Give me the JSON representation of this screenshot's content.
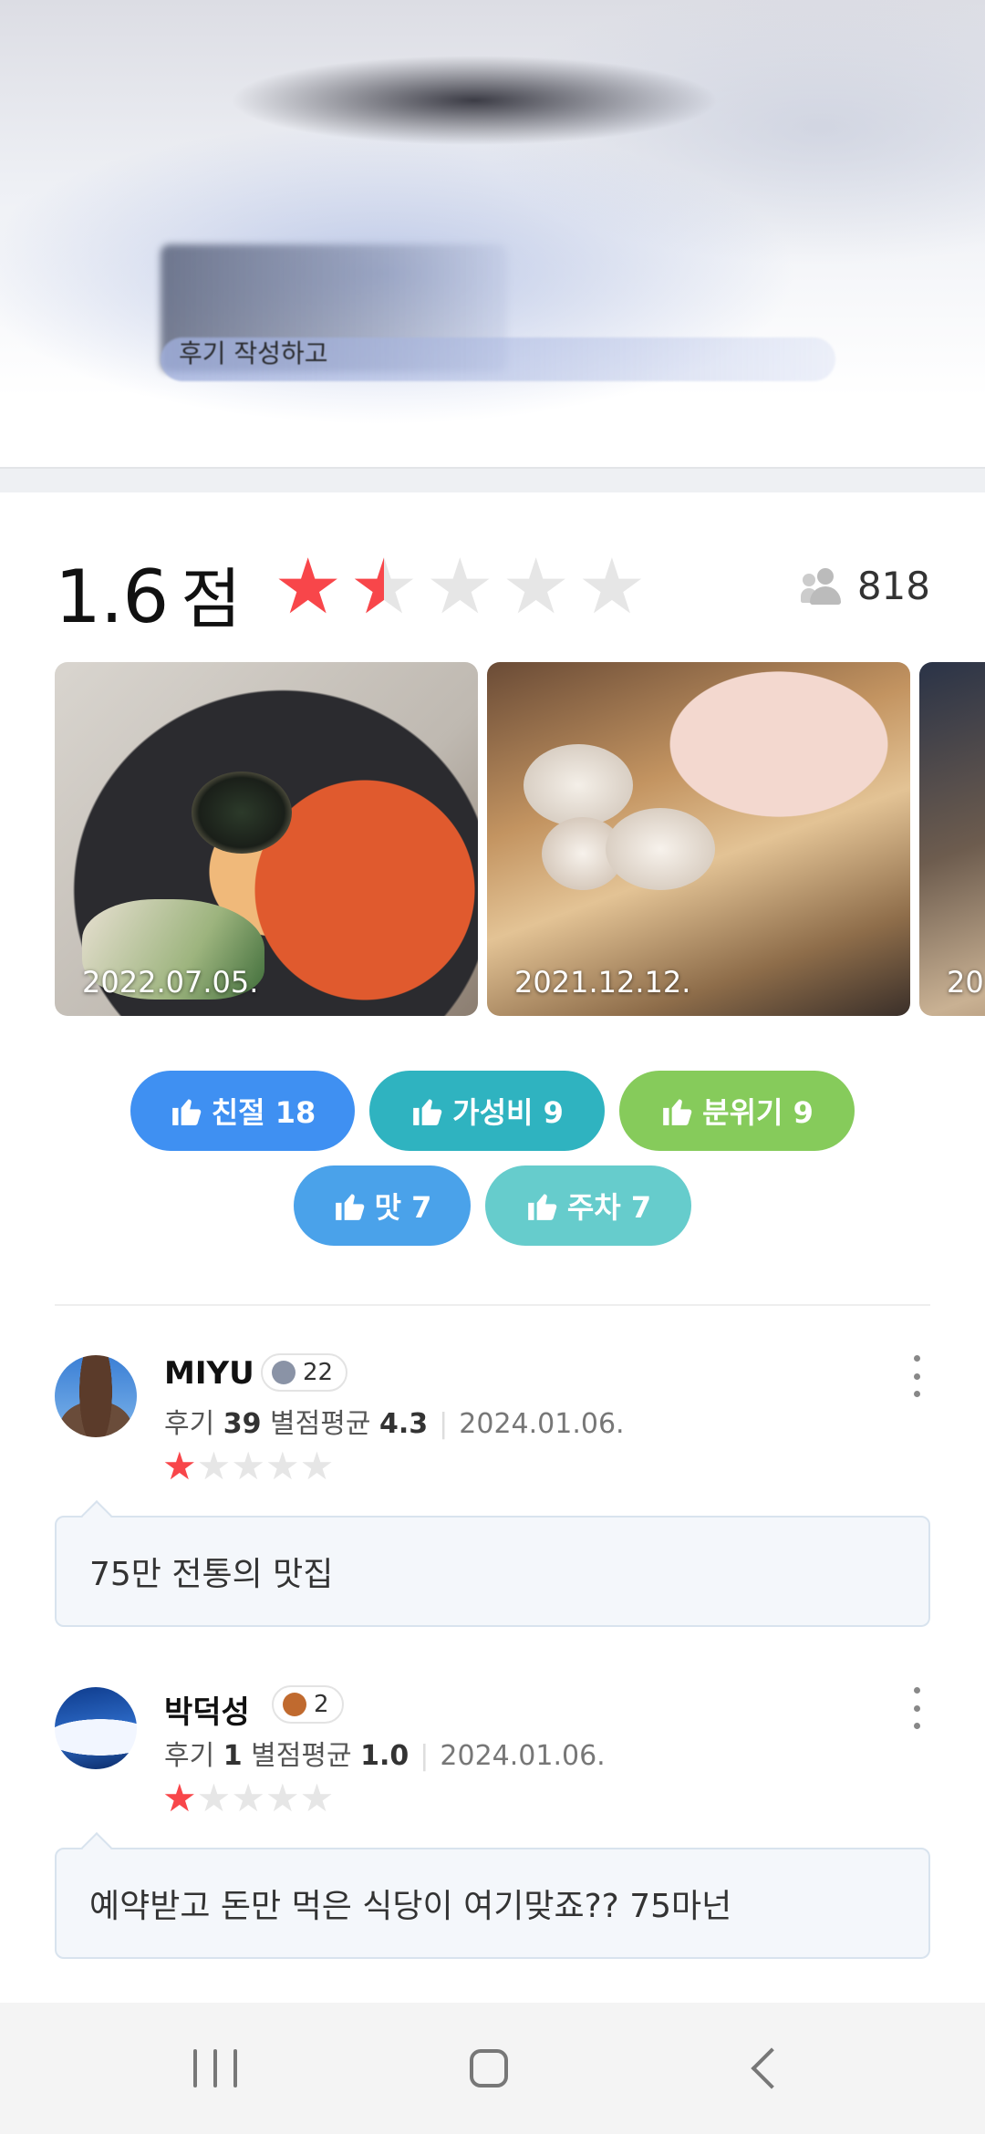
{
  "hero": {
    "caption": "후기 작성하고"
  },
  "rating": {
    "score": "1.6",
    "unit": "점",
    "stars": 1.6,
    "reviewer_count": "818"
  },
  "photos": [
    {
      "date": "2022.07.05."
    },
    {
      "date": "2021.12.12."
    },
    {
      "date": "20"
    }
  ],
  "tags": [
    {
      "label": "친절 18",
      "color": "#3f90f2"
    },
    {
      "label": "가성비 9",
      "color": "#2fb3c0"
    },
    {
      "label": "분위기 9",
      "color": "#86cb5b"
    },
    {
      "label": "맛 7",
      "color": "#4aa2ea"
    },
    {
      "label": "주차 7",
      "color": "#66cccc"
    }
  ],
  "reviews": [
    {
      "name": "MIYU",
      "badge_level": "22",
      "review_count_label": "후기",
      "review_count": "39",
      "avg_label": "별점평균",
      "avg": "4.3",
      "date": "2024.01.06.",
      "stars": 1,
      "text": "75만 전통의 맛집"
    },
    {
      "name": "박덕성",
      "badge_level": "2",
      "review_count_label": "후기",
      "review_count": "1",
      "avg_label": "별점평균",
      "avg": "1.0",
      "date": "2024.01.06.",
      "stars": 1,
      "text": "예약받고 돈만 먹은 식당이 여기맞죠?? 75마넌"
    }
  ],
  "colors": {
    "star_active": "#f8464a",
    "star_inactive": "#e6e6e6"
  },
  "icons": {
    "people": "people-icon",
    "thumb": "thumbs-up-icon",
    "more": "more-vertical-icon",
    "nav_recents": "recents-icon",
    "nav_home": "home-icon",
    "nav_back": "back-icon"
  }
}
